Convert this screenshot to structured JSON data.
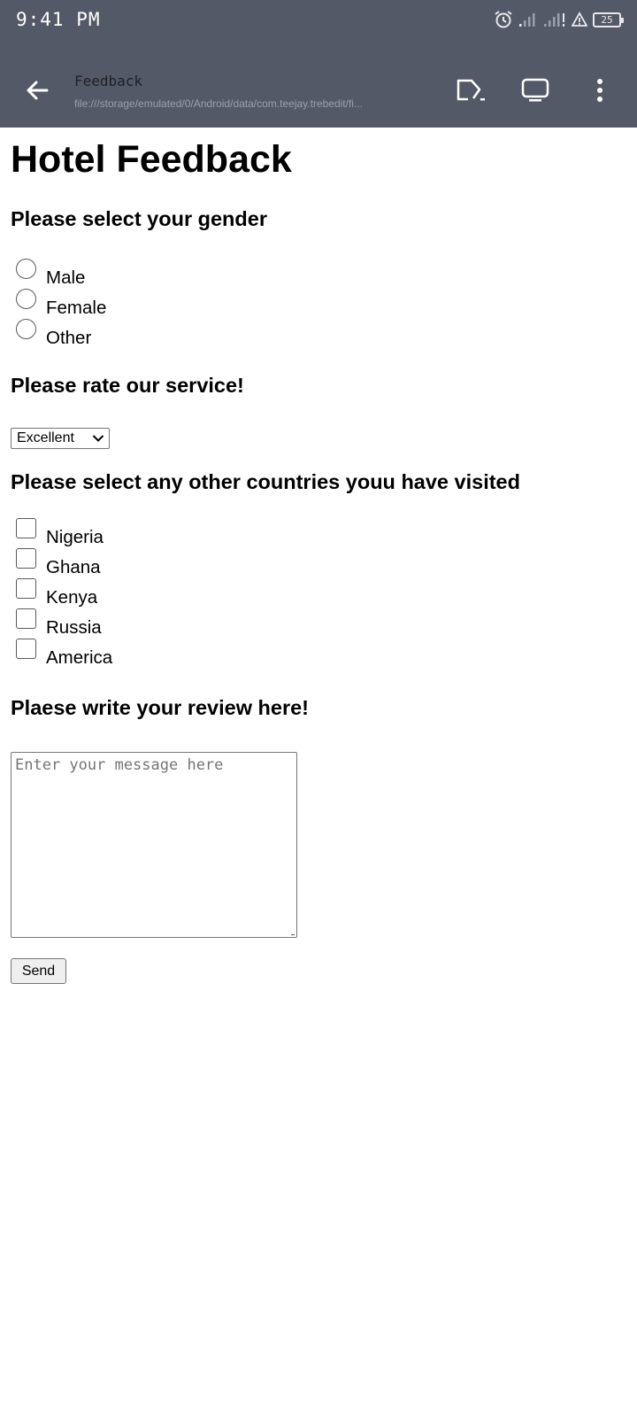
{
  "status_bar": {
    "time": "9:41 PM",
    "battery_level": "25"
  },
  "app_bar": {
    "title": "Feedback",
    "url": "file:///storage/emulated/0/Android/data/com.teejay.trebedit/fi..."
  },
  "page": {
    "title": "Hotel Feedback",
    "gender": {
      "heading": "Please select your gender",
      "options": [
        "Male",
        "Female",
        "Other"
      ]
    },
    "rating": {
      "heading": "Please rate our service!",
      "selected": "Excellent"
    },
    "countries": {
      "heading": "Please select any other countries youu have visited",
      "options": [
        "Nigeria",
        "Ghana",
        "Kenya",
        "Russia",
        "America"
      ]
    },
    "review": {
      "heading": "Plaese write your review here!",
      "placeholder": "Enter your message here"
    },
    "send_label": "Send"
  },
  "colors": {
    "app_bar_bg": "#545968",
    "page_bg": "#ffffff"
  },
  "icons": [
    "back-arrow-icon",
    "open-in-icon",
    "desktop-view-icon",
    "more-vert-icon",
    "alarm-icon",
    "signal-icon",
    "alert-icon",
    "battery-icon"
  ]
}
